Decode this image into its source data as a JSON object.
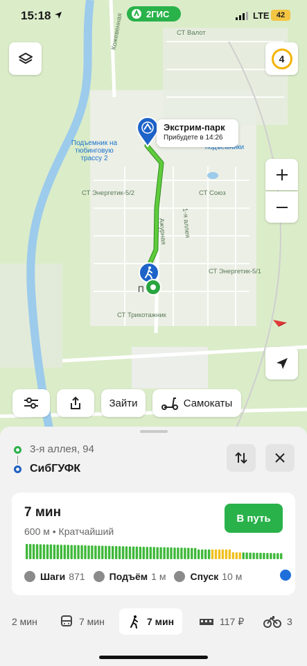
{
  "status_bar": {
    "time": "15:18",
    "brand": "2ГИС",
    "network": "LTE",
    "battery": "42"
  },
  "map": {
    "level_badge": "4",
    "destination_callout": {
      "name": "Экстрим-парк",
      "eta": "Прибудете в 14:26"
    },
    "labels": [
      "Подъемник на тюбинговую трассу 2",
      "подъемники",
      "СТ Энергетик-5/2",
      "СТ Союз",
      "СТ Энергетик-5/1",
      "СТ Трикотажник",
      "1-я аллея",
      "Ажурная",
      "Кожевенная",
      "СТ Валот"
    ],
    "start_label": "П",
    "route_color": "#45b535"
  },
  "chips": {
    "enter_label": "Зайти",
    "scooters_label": "Самокаты"
  },
  "route": {
    "from": "3-я аллея, 94",
    "to": "СибГУФК"
  },
  "card": {
    "duration": "7 мин",
    "meta": "600 м • Кратчайший",
    "go_label": "В путь",
    "stats": [
      {
        "label": "Шаги",
        "value": "871"
      },
      {
        "label": "Подъём",
        "value": "1 м"
      },
      {
        "label": "Спуск",
        "value": "10 м"
      }
    ]
  },
  "modes": [
    {
      "label": "2 мин"
    },
    {
      "label": "7 мин"
    },
    {
      "label": "7 мин"
    },
    {
      "label": "117 ₽"
    },
    {
      "label": "3"
    }
  ]
}
